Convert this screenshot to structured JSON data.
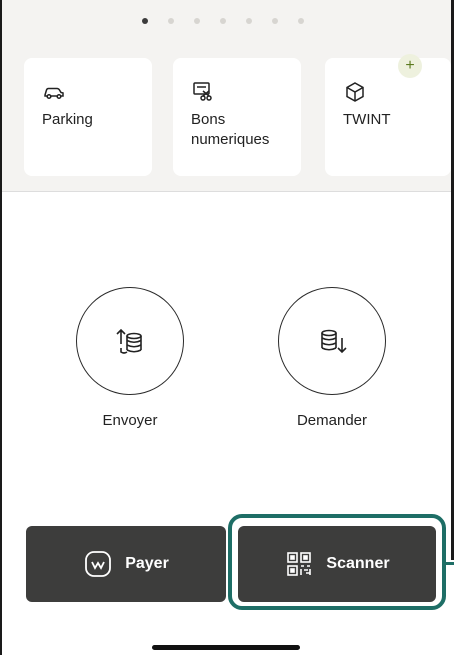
{
  "pager": {
    "count": 7,
    "active_index": 0
  },
  "shortcuts": [
    {
      "label": "Parking",
      "icon": "car-icon"
    },
    {
      "label": "Bons\nnumeriques",
      "icon": "voucher-icon"
    },
    {
      "label": "TWINT",
      "icon": "cube-icon"
    }
  ],
  "add_badge": {
    "symbol": "+",
    "icon": "plus-icon"
  },
  "actions": {
    "send_label": "Envoyer",
    "request_label": "Demander"
  },
  "bottom_bar": {
    "pay_label": "Payer",
    "scan_label": "Scanner"
  },
  "colors": {
    "button_bg": "#3d3d3c",
    "highlight": "#1e6e66",
    "band_bg": "#f4f3f1",
    "badge_bg": "#eef1de",
    "badge_fg": "#5b7a1e"
  }
}
